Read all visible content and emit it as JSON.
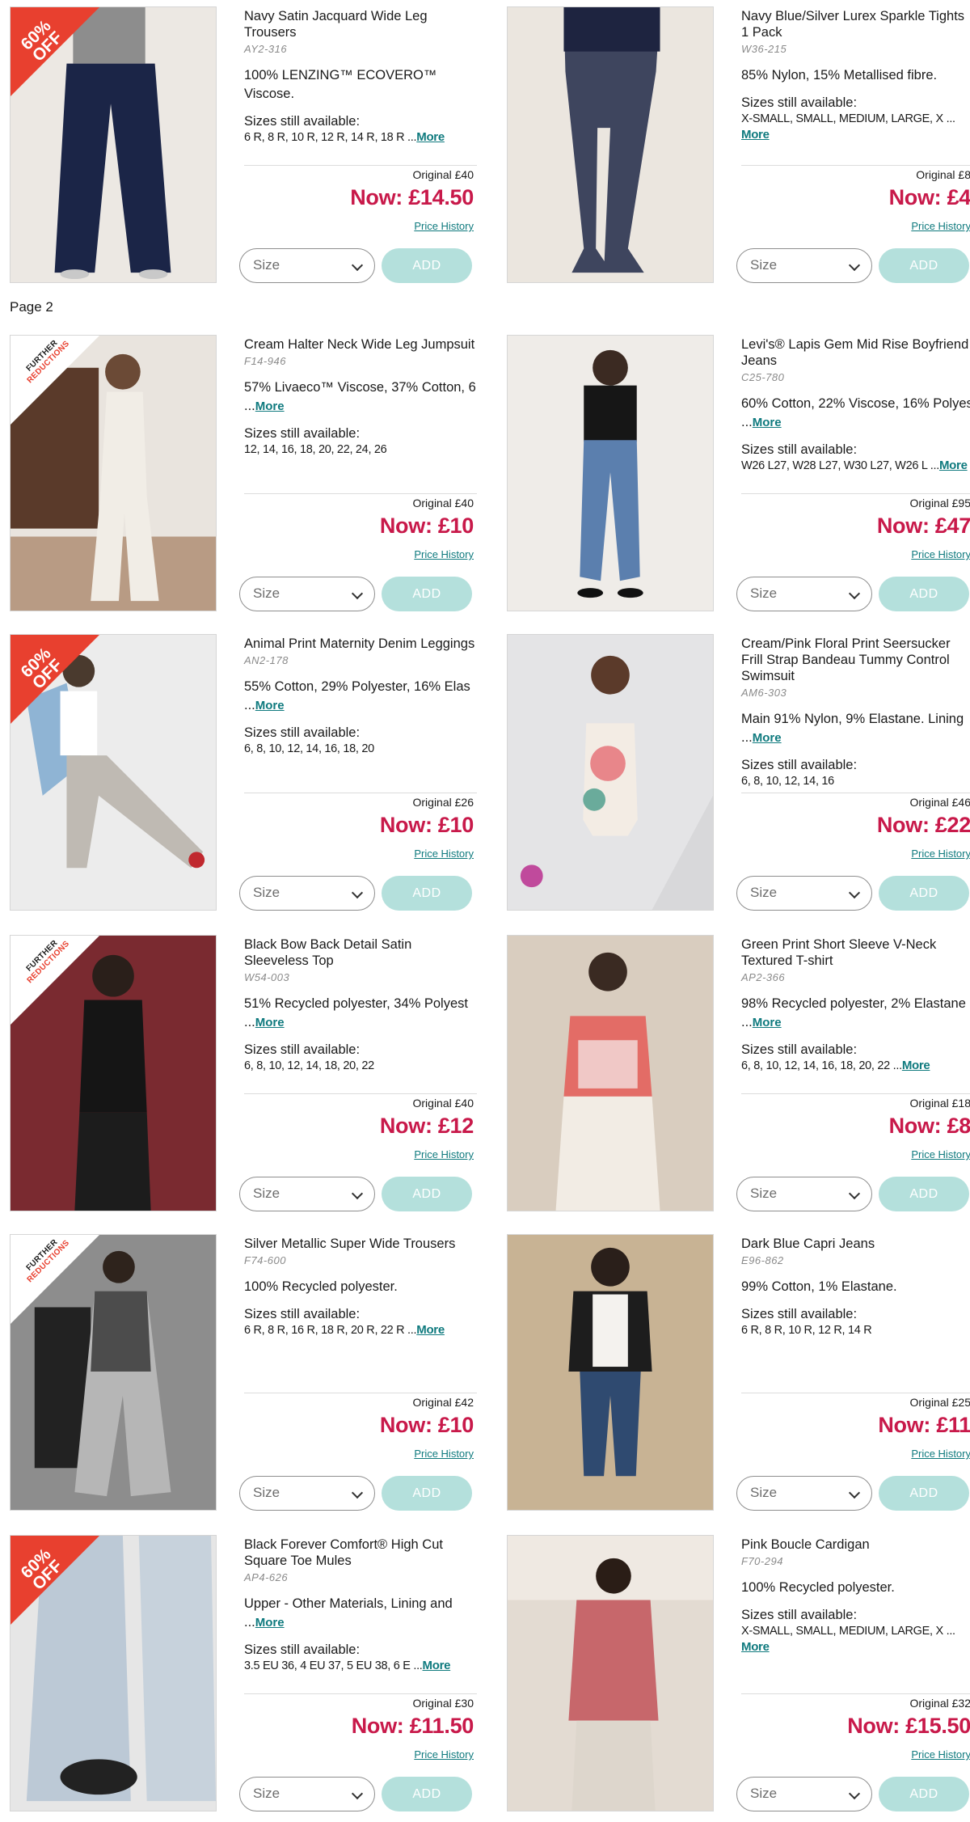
{
  "page_label": "Page 2",
  "common": {
    "size_placeholder": "Size",
    "add_label": "ADD",
    "price_history": "Price History",
    "sizes_heading": "Sizes still available:",
    "more": "More",
    "badge_60_line1": "60%",
    "badge_60_line2": "OFF",
    "badge_fr_line1": "FURTHER",
    "badge_fr_line2": "REDUCTIONS"
  },
  "products": [
    {
      "title": "Navy Satin Jacquard Wide Leg Trousers",
      "code": "AY2-316",
      "composition": "100% LENZING™ ECOVERO™ Viscose.",
      "comp_more": false,
      "sizes": "6 R, 8 R, 10 R, 12 R, 14 R, 18 R ...",
      "sizes_more": true,
      "original": "Original £40",
      "now": "Now: £14.50",
      "badge": "60off",
      "img_color": "#ece8e3"
    },
    {
      "title": "Navy Blue/Silver Lurex Sparkle Tights 1 Pack",
      "code": "W36-215",
      "composition": "85% Nylon, 15% Metallised fibre.",
      "comp_more": false,
      "sizes": "X-SMALL, SMALL, MEDIUM, LARGE, X ...",
      "sizes_more": true,
      "original": "Original £8",
      "now": "Now: £4",
      "badge": "",
      "img_color": "#ebe6df"
    },
    {
      "title": "Cream Halter Neck Wide Leg Jumpsuit",
      "code": "F14-946",
      "composition": "57% Livaeco™ Viscose, 37% Cotton, 6 ...",
      "comp_more": true,
      "sizes": "12, 14, 16, 18, 20, 22, 24, 26",
      "sizes_more": false,
      "original": "Original £40",
      "now": "Now: £10",
      "badge": "further",
      "img_color": "#e9e4de"
    },
    {
      "title": "Levi's® Lapis Gem Mid Rise Boyfriend Jeans",
      "code": "C25-780",
      "composition": "60% Cotton, 22% Viscose, 16% Polyes ...",
      "comp_more": true,
      "sizes": "W26 L27, W28 L27, W30 L27, W26 L ...",
      "sizes_more": true,
      "original": "Original £95",
      "now": "Now: £47",
      "badge": "",
      "img_color": "#efece8"
    },
    {
      "title": "Animal Print Maternity Denim Leggings",
      "code": "AN2-178",
      "composition": "55% Cotton, 29% Polyester, 16% Elas ...",
      "comp_more": true,
      "sizes": "6, 8, 10, 12, 14, 16, 18, 20",
      "sizes_more": false,
      "original": "Original £26",
      "now": "Now: £10",
      "badge": "60off",
      "img_color": "#ececec"
    },
    {
      "title": "Cream/Pink Floral Print Seersucker Frill Strap Bandeau Tummy Control Swimsuit",
      "code": "AM6-303",
      "composition": "Main 91% Nylon, 9% Elastane. Lining ...",
      "comp_more": true,
      "sizes": "6, 8, 10, 12, 14, 16",
      "sizes_more": false,
      "original": "Original £46",
      "now": "Now: £22",
      "badge": "",
      "img_color": "#e4e4e6"
    },
    {
      "title": "Black Bow Back Detail Satin Sleeveless Top",
      "code": "W54-003",
      "composition": "51% Recycled polyester, 34% Polyest ...",
      "comp_more": true,
      "sizes": "6, 8, 10, 12, 14, 18, 20, 22",
      "sizes_more": false,
      "original": "Original £40",
      "now": "Now: £12",
      "badge": "further",
      "img_color": "#7a2a30"
    },
    {
      "title": "Green Print Short Sleeve V-Neck Textured T-shirt",
      "code": "AP2-366",
      "composition": "98% Recycled polyester, 2% Elastane ...",
      "comp_more": true,
      "sizes": "6, 8, 10, 12, 14, 16, 18, 20, 22 ...",
      "sizes_more": true,
      "original": "Original £18",
      "now": "Now: £8",
      "badge": "",
      "img_color": "#d9cdbf"
    },
    {
      "title": "Silver Metallic Super Wide Trousers",
      "code": "F74-600",
      "composition": "100% Recycled polyester.",
      "comp_more": false,
      "sizes": "6 R, 8 R, 16 R, 18 R, 20 R, 22 R ...",
      "sizes_more": true,
      "original": "Original £42",
      "now": "Now: £10",
      "badge": "further",
      "img_color": "#8d8d8d"
    },
    {
      "title": "Dark Blue Capri Jeans",
      "code": "E96-862",
      "composition": "99% Cotton, 1% Elastane.",
      "comp_more": false,
      "sizes": "6 R, 8 R, 10 R, 12 R, 14 R",
      "sizes_more": false,
      "original": "Original £25",
      "now": "Now: £11",
      "badge": "",
      "img_color": "#c8b394"
    },
    {
      "title": "Black Forever Comfort® High Cut Square Toe Mules",
      "code": "AP4-626",
      "composition": "Upper - Other Materials, Lining and ...",
      "comp_more": true,
      "sizes": "3.5 EU 36, 4 EU 37, 5 EU 38, 6 E ...",
      "sizes_more": true,
      "original": "Original £30",
      "now": "Now: £11.50",
      "badge": "60off",
      "img_color": "#e6e6e6"
    },
    {
      "title": "Pink Boucle Cardigan",
      "code": "F70-294",
      "composition": "100% Recycled polyester.",
      "comp_more": false,
      "sizes": "X-SMALL, SMALL, MEDIUM, LARGE, X ...",
      "sizes_more": true,
      "original": "Original £32",
      "now": "Now: £15.50",
      "badge": "",
      "img_color": "#e3dbd2"
    }
  ]
}
